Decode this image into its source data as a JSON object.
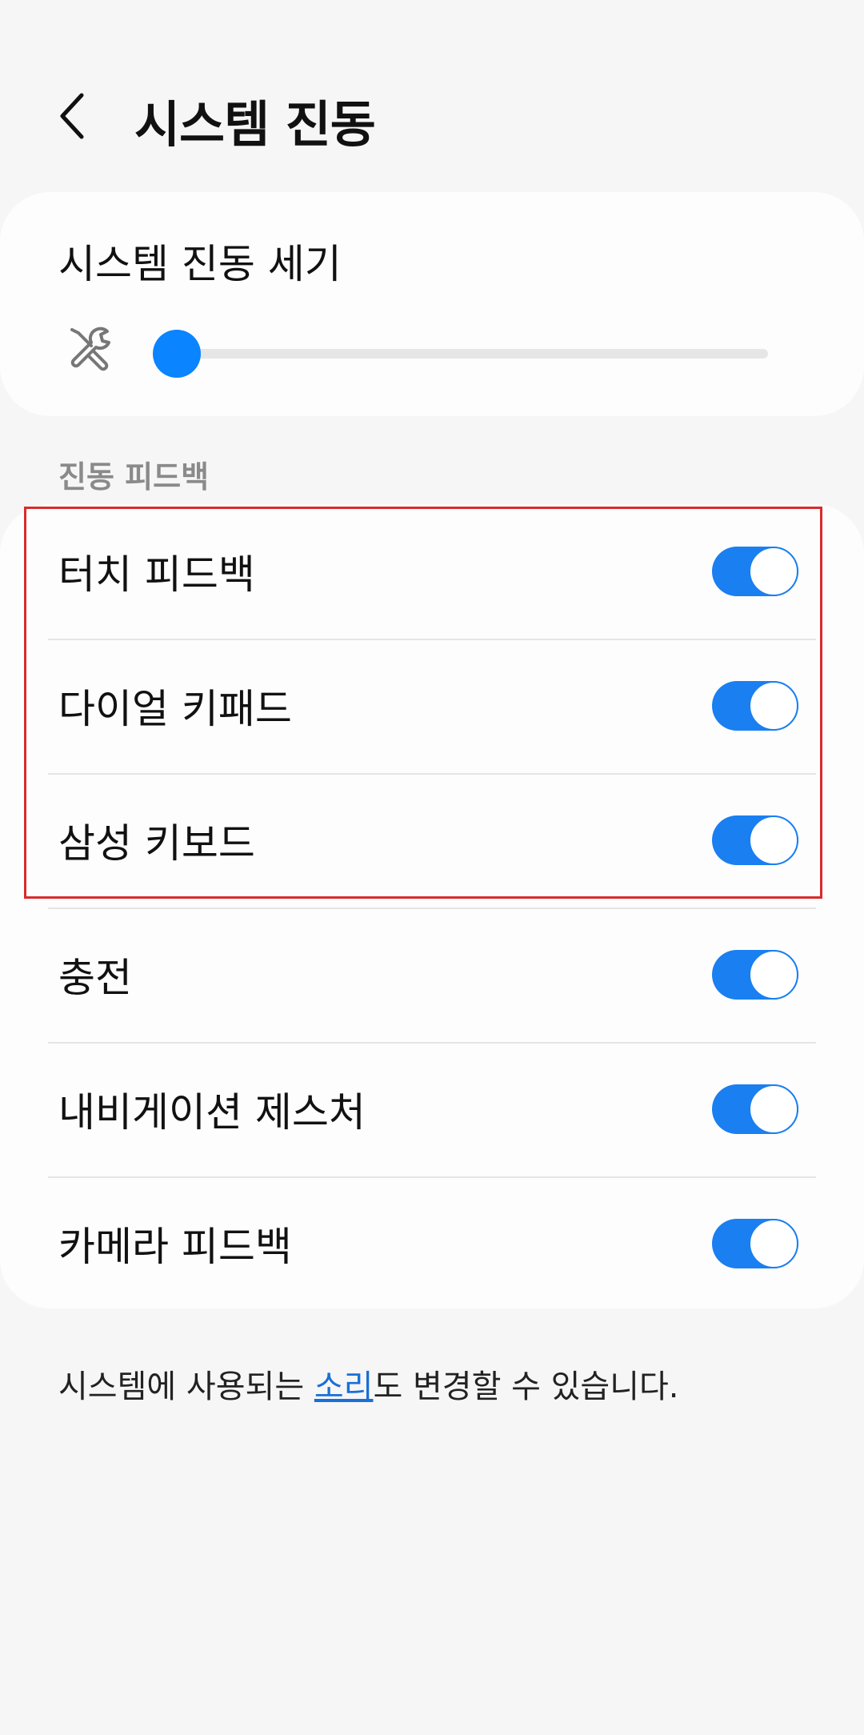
{
  "header": {
    "title": "시스템 진동",
    "back_icon": "chevron-left-icon"
  },
  "intensity": {
    "title": "시스템 진동 세기",
    "icon": "wrench-screwdriver-icon",
    "level_fraction": 0.0,
    "accent_color": "#0a84ff"
  },
  "feedback_section": {
    "header": "진동 피드백",
    "items": [
      {
        "label": "터치 피드백",
        "enabled": true
      },
      {
        "label": "다이얼 키패드",
        "enabled": true
      },
      {
        "label": "삼성 키보드",
        "enabled": true
      },
      {
        "label": "충전",
        "enabled": true
      },
      {
        "label": "내비게이션 제스처",
        "enabled": true
      },
      {
        "label": "카메라 피드백",
        "enabled": true
      }
    ],
    "toggle_on_color": "#1a7ff0",
    "highlight_color": "#d92b2b"
  },
  "footer": {
    "text_before": "시스템에 사용되는 ",
    "link_text": "소리",
    "text_after": "도 변경할 수 있습니다."
  }
}
